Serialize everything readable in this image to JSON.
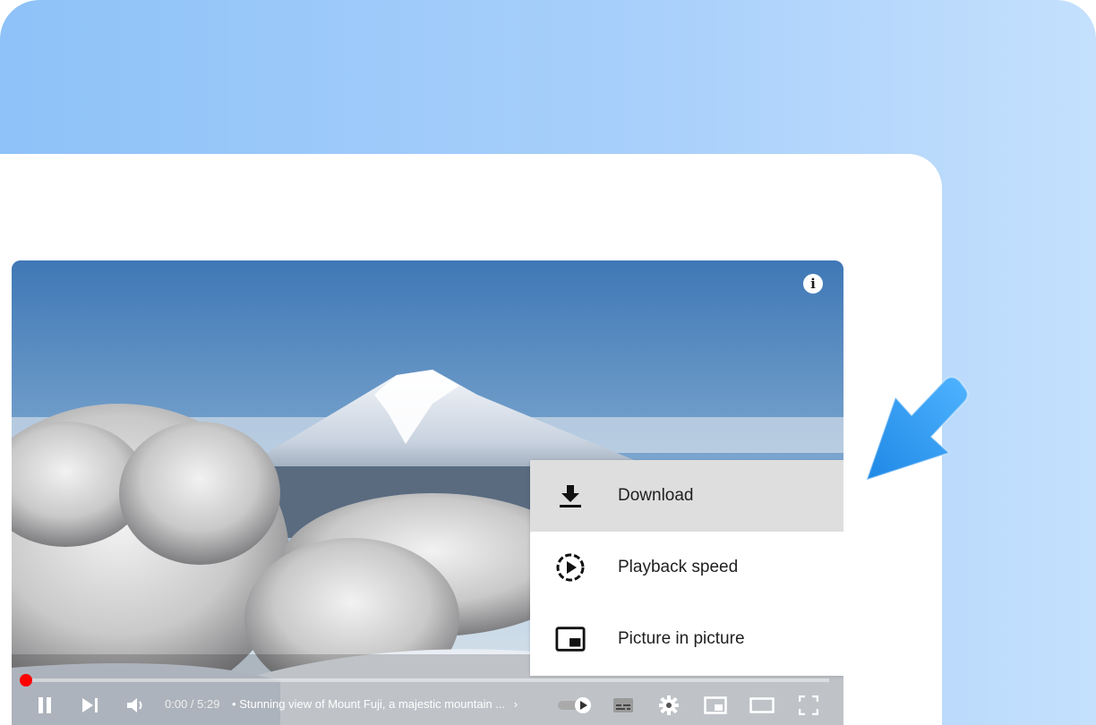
{
  "video": {
    "time_current": "0:00",
    "time_separator": " / ",
    "time_total": "5:29",
    "title_prefix": "•",
    "title": "Stunning view of Mount Fuji, a majestic mountain ...",
    "progress_fraction": 0.0,
    "info_label": "i"
  },
  "menu": {
    "items": [
      {
        "label": "Download",
        "icon": "download-icon",
        "active": true
      },
      {
        "label": "Playback speed",
        "icon": "playback-speed-icon",
        "active": false
      },
      {
        "label": "Picture in picture",
        "icon": "picture-in-picture-icon",
        "active": false
      }
    ]
  },
  "controls": {
    "buttons": [
      "pause-icon",
      "next-icon",
      "volume-icon",
      "autoplay-toggle",
      "subtitles-icon",
      "settings-icon",
      "miniplayer-icon",
      "theater-icon",
      "fullscreen-icon"
    ]
  },
  "colors": {
    "background_gradient_start": "#8ec2f8",
    "background_gradient_end": "#c4e0fd",
    "progress_red": "#ff0000",
    "menu_highlight": "#dedede",
    "pointer_arrow": "#2196f3"
  }
}
